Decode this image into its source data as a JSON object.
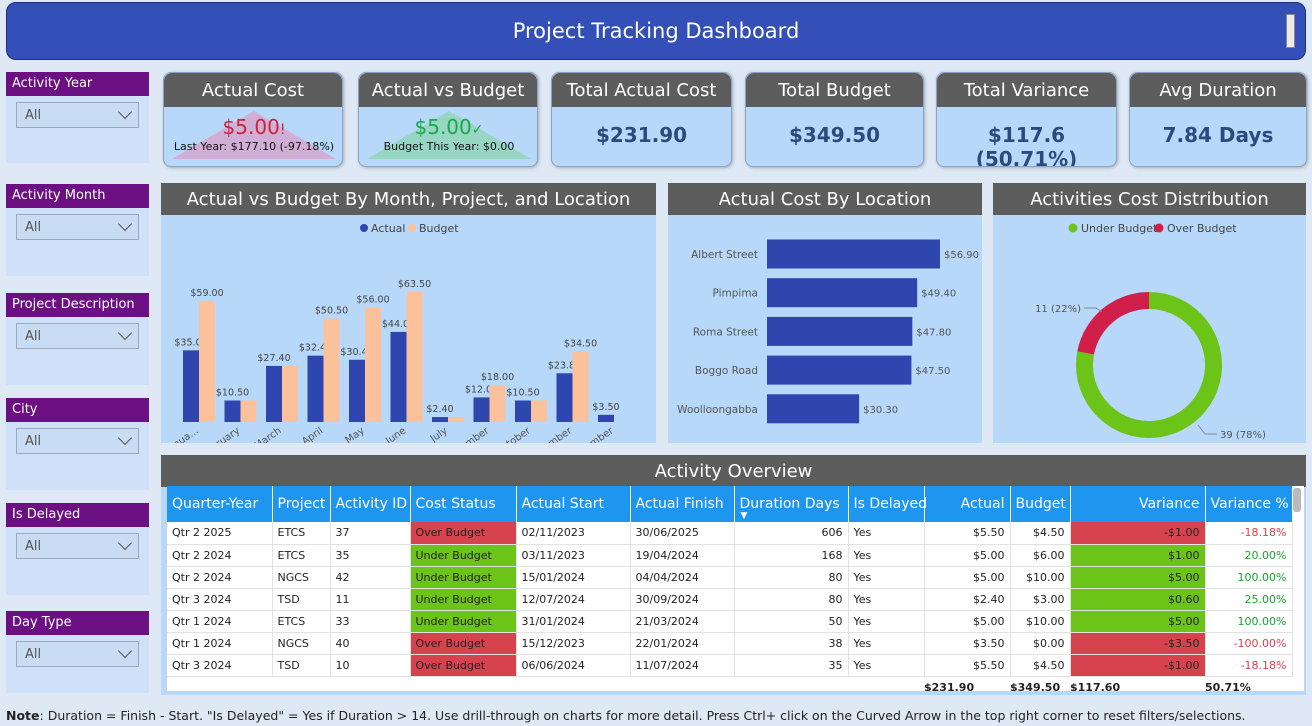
{
  "header": {
    "title": "Project Tracking Dashboard"
  },
  "slicers": [
    {
      "title": "Activity Year",
      "value": "All"
    },
    {
      "title": "Activity Month",
      "value": "All"
    },
    {
      "title": "Project Description",
      "value": "All"
    },
    {
      "title": "City",
      "value": "All"
    },
    {
      "title": "Is Delayed",
      "value": "All"
    },
    {
      "title": "Day Type",
      "value": "All"
    }
  ],
  "kpis": {
    "actual_cost": {
      "title": "Actual Cost",
      "value": "$5.00",
      "mark": "!",
      "sub": "Last Year: $177.10 (-97.18%)"
    },
    "actual_vs_budget": {
      "title": "Actual vs Budget",
      "value": "$5.00",
      "mark": "✓",
      "sub": "Budget This Year: $0.00"
    },
    "total_actual_cost": {
      "title": "Total Actual Cost",
      "value": "$231.90"
    },
    "total_budget": {
      "title": "Total Budget",
      "value": "$349.50"
    },
    "total_variance": {
      "title": "Total Variance",
      "value": "$117.6 (50.71%)"
    },
    "avg_duration": {
      "title": "Avg Duration",
      "value": "7.84 Days"
    }
  },
  "colors": {
    "actual": "#2e46ad",
    "budget": "#fbc19a",
    "under_budget": "#6cc419",
    "over_budget": "#d21f4a",
    "slicer_title": "#6b0f83",
    "header": "#3450b8"
  },
  "chart_data": [
    {
      "type": "bar",
      "title": "Actual vs Budget By Month, Project, and Location",
      "categories": [
        "Janua...",
        "February",
        "March",
        "April",
        "May",
        "June",
        "July",
        "September",
        "October",
        "November",
        "December"
      ],
      "series": [
        {
          "name": "Actual",
          "values": [
            35.0,
            10.5,
            27.4,
            32.4,
            30.4,
            44.0,
            2.4,
            12.0,
            10.5,
            23.8,
            3.5
          ],
          "labels": [
            "$35.00",
            "$10.50",
            "$27.40",
            "$32.40",
            "$30.40",
            "$44.00",
            "$2.40",
            "$12.00",
            "$10.50",
            "$23.80",
            "$3.50"
          ]
        },
        {
          "name": "Budget",
          "values": [
            59.0,
            10.5,
            27.4,
            50.5,
            56.0,
            63.5,
            2.4,
            18.0,
            10.5,
            34.5,
            0
          ],
          "labels": [
            "$59.00",
            "",
            "",
            "$50.50",
            "$56.00",
            "$63.50",
            "",
            "$18.00",
            "",
            "$34.50",
            ""
          ]
        }
      ],
      "legend": "top-center"
    },
    {
      "type": "bar",
      "orientation": "horizontal",
      "title": "Actual Cost By Location",
      "categories": [
        "Albert Street",
        "Pimpima",
        "Roma Street",
        "Boggo Road",
        "Woolloongabba"
      ],
      "values": [
        56.9,
        49.4,
        47.8,
        47.5,
        30.3
      ],
      "labels": [
        "$56.90",
        "$49.40",
        "$47.80",
        "$47.50",
        "$30.30"
      ]
    },
    {
      "type": "pie",
      "title": "Activities Cost Distribution",
      "categories": [
        "Under Budget",
        "Over Budget"
      ],
      "values": [
        39,
        11
      ],
      "labels": [
        "39 (78%)",
        "11 (22%)"
      ],
      "legend": "top-center"
    }
  ],
  "table": {
    "title": "Activity Overview",
    "columns": [
      "Quarter-Year",
      "Project",
      "Activity ID",
      "Cost Status",
      "Actual Start",
      "Actual Finish",
      "Duration Days",
      "Is Delayed",
      "Actual",
      "Budget",
      "Variance",
      "Variance %"
    ],
    "rows": [
      [
        "Qtr 2 2025",
        "ETCS",
        "37",
        "Over Budget",
        "02/11/2023",
        "30/06/2025",
        "606",
        "Yes",
        "$5.50",
        "$4.50",
        "-$1.00",
        "-18.18%"
      ],
      [
        "Qtr 2 2024",
        "ETCS",
        "35",
        "Under Budget",
        "03/11/2023",
        "19/04/2024",
        "168",
        "Yes",
        "$5.00",
        "$6.00",
        "$1.00",
        "20.00%"
      ],
      [
        "Qtr 2 2024",
        "NGCS",
        "42",
        "Under Budget",
        "15/01/2024",
        "04/04/2024",
        "80",
        "Yes",
        "$5.00",
        "$10.00",
        "$5.00",
        "100.00%"
      ],
      [
        "Qtr 3 2024",
        "TSD",
        "11",
        "Under Budget",
        "12/07/2024",
        "30/09/2024",
        "80",
        "Yes",
        "$2.40",
        "$3.00",
        "$0.60",
        "25.00%"
      ],
      [
        "Qtr 1 2024",
        "ETCS",
        "33",
        "Under Budget",
        "31/01/2024",
        "21/03/2024",
        "50",
        "Yes",
        "$5.00",
        "$10.00",
        "$5.00",
        "100.00%"
      ],
      [
        "Qtr 1 2024",
        "NGCS",
        "40",
        "Over Budget",
        "15/12/2023",
        "22/01/2024",
        "38",
        "Yes",
        "$3.50",
        "$0.00",
        "-$3.50",
        "-100.00%"
      ],
      [
        "Qtr 3 2024",
        "TSD",
        "10",
        "Over Budget",
        "06/06/2024",
        "11/07/2024",
        "35",
        "Yes",
        "$5.50",
        "$4.50",
        "-$1.00",
        "-18.18%"
      ]
    ],
    "totals": {
      "actual": "$231.90",
      "budget": "$349.50",
      "variance": "$117.60",
      "variance_pct": "50.71%"
    }
  },
  "note": {
    "label": "Note",
    "text": ": Duration = Finish - Start. \"Is Delayed\" = Yes if Duration > 14. Use drill-through on charts for more detail.  Press Ctrl+ click on the Curved Arrow in the top right corner to reset filters/selections."
  }
}
